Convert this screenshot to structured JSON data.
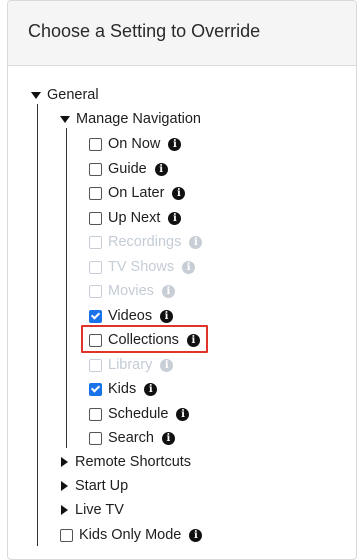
{
  "panel": {
    "title": "Choose a Setting to Override"
  },
  "tree": {
    "general": {
      "label": "General"
    },
    "manage_navigation": {
      "label": "Manage Navigation",
      "items": [
        {
          "label": "On Now",
          "checked": false,
          "disabled": false,
          "icon": "info-icon"
        },
        {
          "label": "Guide",
          "checked": false,
          "disabled": false,
          "icon": "info-icon"
        },
        {
          "label": "On Later",
          "checked": false,
          "disabled": false,
          "icon": "info-icon"
        },
        {
          "label": "Up Next",
          "checked": false,
          "disabled": false,
          "icon": "info-icon"
        },
        {
          "label": "Recordings",
          "checked": false,
          "disabled": true,
          "icon": "info-icon"
        },
        {
          "label": "TV Shows",
          "checked": false,
          "disabled": true,
          "icon": "info-icon"
        },
        {
          "label": "Movies",
          "checked": false,
          "disabled": true,
          "icon": "info-icon"
        },
        {
          "label": "Videos",
          "checked": true,
          "disabled": false,
          "icon": "info-icon"
        },
        {
          "label": "Collections",
          "checked": false,
          "disabled": false,
          "icon": "info-icon",
          "highlighted": true
        },
        {
          "label": "Library",
          "checked": false,
          "disabled": true,
          "icon": "info-icon"
        },
        {
          "label": "Kids",
          "checked": true,
          "disabled": false,
          "icon": "info-icon"
        },
        {
          "label": "Schedule",
          "checked": false,
          "disabled": false,
          "icon": "info-icon"
        },
        {
          "label": "Search",
          "checked": false,
          "disabled": false,
          "icon": "info-icon"
        }
      ]
    },
    "remote_shortcuts": {
      "label": "Remote Shortcuts"
    },
    "start_up": {
      "label": "Start Up"
    },
    "live_tv": {
      "label": "Live TV"
    },
    "kids_only_mode": {
      "label": "Kids Only Mode",
      "checked": false,
      "icon": "info-icon"
    }
  },
  "colors": {
    "highlight": "#e0342b",
    "checkbox_checked": "#1a73e8",
    "disabled_text": "#c4ccd6"
  }
}
